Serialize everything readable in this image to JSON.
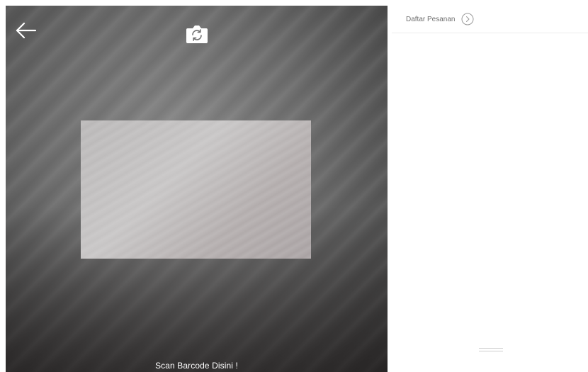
{
  "scanner": {
    "caption": "Scan Barcode Disini !",
    "back_icon": "arrow-left-icon",
    "flip_icon": "camera-switch-icon"
  },
  "order_panel": {
    "title": "Daftar Pesanan",
    "chevron_icon": "chevron-right-circle-icon"
  },
  "colors": {
    "caption_text": "#ffffff",
    "title_text": "#6f6f6f",
    "divider": "#ececec",
    "icon_outline": "#9a9a9a"
  }
}
